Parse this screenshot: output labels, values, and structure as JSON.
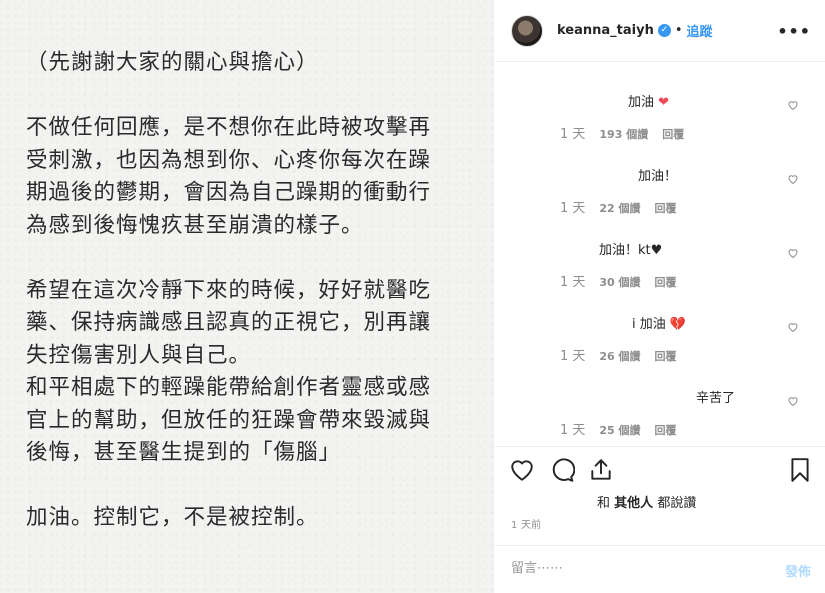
{
  "post": {
    "lines": [
      "（先謝謝大家的關心與擔心）",
      "",
      "不做任何回應，是不想你在此時被攻擊再",
      "受刺激，也因為想到你、心疼你每次在躁",
      "期過後的鬱期，會因為自己躁期的衝動行",
      "為感到後悔愧疚甚至崩潰的樣子。",
      "",
      "希望在這次冷靜下來的時候，好好就醫吃",
      "藥、保持病識感且認真的正視它，別再讓",
      "失控傷害別人與自己。",
      "和平相處下的輕躁能帶給創作者靈感或感",
      "官上的幫助，但放任的狂躁會帶來毀滅與",
      "後悔，甚至醫生提到的「傷腦」",
      "",
      "加油。控制它，不是被控制。"
    ]
  },
  "header": {
    "username": "keanna_taiyh",
    "separator": "•",
    "follow_label": "追蹤",
    "more_glyph": "•••",
    "verified_glyph": "✓"
  },
  "comments": [
    {
      "text": "加油",
      "emoji": "❤",
      "time": "1 天",
      "likes": "193 個讚",
      "reply": "回覆"
    },
    {
      "text": "加油！",
      "emoji": "",
      "time": "1 天",
      "likes": "22 個讚",
      "reply": "回覆"
    },
    {
      "text": "加油！kt♥",
      "emoji": "",
      "time": "1 天",
      "likes": "30 個讚",
      "reply": "回覆"
    },
    {
      "text": "i 加油",
      "emoji": "💔",
      "time": "1 天",
      "likes": "26 個讚",
      "reply": "回覆"
    },
    {
      "text": "辛苦了",
      "emoji": "",
      "time": "1 天",
      "likes": "25 個讚",
      "reply": "回覆"
    }
  ],
  "likes": {
    "prefix": "和",
    "others": "其他人",
    "suffix": "都說讚"
  },
  "post_time": "1 天前",
  "composer": {
    "placeholder": "留言⋯⋯",
    "post_label": "發佈"
  },
  "colors": {
    "accent": "#3897f0",
    "heart_red": "#ed4956",
    "muted": "#8e8e8e"
  }
}
